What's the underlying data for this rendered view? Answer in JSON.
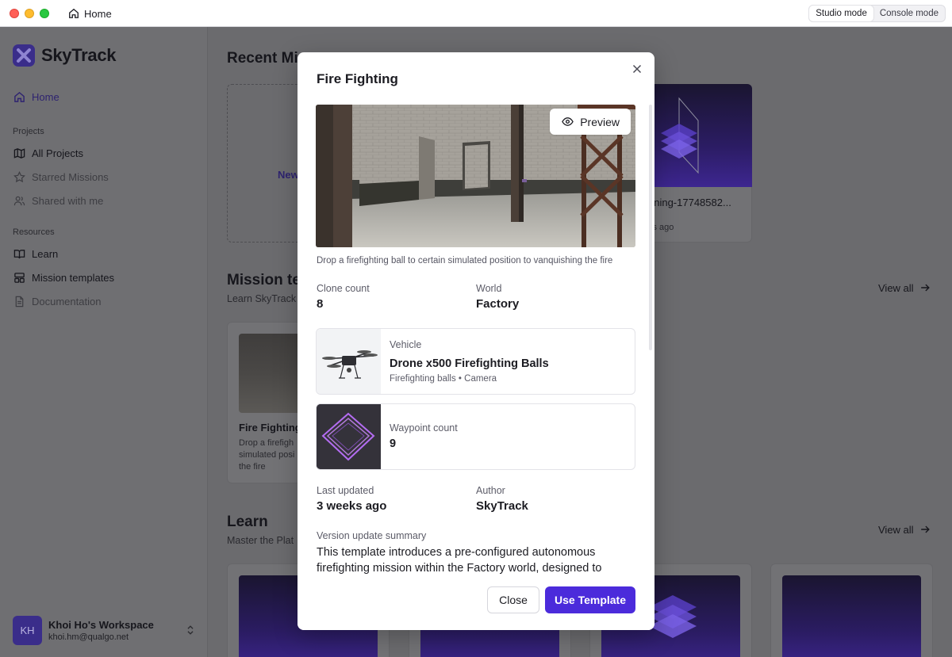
{
  "titlebar": {
    "home_label": "Home",
    "modes": [
      {
        "label": "Studio mode",
        "active": true
      },
      {
        "label": "Console mode",
        "active": false
      }
    ]
  },
  "sidebar": {
    "brand": "SkyTrack",
    "home": "Home",
    "projects_section": "Projects",
    "projects": [
      "All Projects",
      "Starred Missions",
      "Shared with me"
    ],
    "resources_section": "Resources",
    "resources": [
      "Learn",
      "Mission templates",
      "Documentation"
    ],
    "workspace": {
      "initials": "KH",
      "name": "Khoi Ho's Workspace",
      "email": "khoi.hm@qualgo.net"
    }
  },
  "background": {
    "recent_title": "Recent Mi",
    "new_label": "New",
    "recent_card_name": "nning-17748582...",
    "recent_card_time": "ks ago",
    "templates_title": "Mission te",
    "templates_sub": "Learn SkyTrack",
    "view_all": "View all",
    "template_card_title": "Fire Fighting",
    "template_card_desc": [
      "Drop a firefigh",
      "simulated posi",
      "the fire"
    ],
    "learn_title": "Learn",
    "learn_sub": "Master the Plat"
  },
  "modal": {
    "title": "Fire Fighting",
    "preview_label": "Preview",
    "description": "Drop a firefighting ball to certain simulated position to vanquishing the fire",
    "clone_count_label": "Clone count",
    "clone_count": "8",
    "world_label": "World",
    "world": "Factory",
    "vehicle_label": "Vehicle",
    "vehicle_name": "Drone x500 Firefighting Balls",
    "vehicle_meta": "Firefighting balls • Camera",
    "waypoint_label": "Waypoint count",
    "waypoint_count": "9",
    "last_updated_label": "Last updated",
    "last_updated": "3 weeks ago",
    "author_label": "Author",
    "author": "SkyTrack",
    "summary_label": "Version update summary",
    "summary": "This template introduces a pre-configured autonomous firefighting mission within the Factory world, designed to",
    "close_label": "Close",
    "use_label": "Use Template"
  },
  "colors": {
    "accent": "#4b2bdb",
    "brand_dark": "#3a2d8a"
  }
}
